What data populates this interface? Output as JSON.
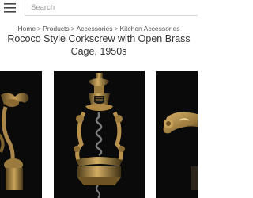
{
  "search": {
    "placeholder": "Search"
  },
  "breadcrumb": {
    "items": [
      "Home",
      "Products",
      "Accessories",
      "Kitchen Accessories"
    ],
    "separator": ">"
  },
  "product": {
    "title_lines": [
      "Rococo Style Corkscrew with Open Brass",
      "Cage, 1950s"
    ]
  },
  "colors": {
    "image_background": "#0a0a0a",
    "brass": "#b08a45",
    "text": "#333333"
  },
  "icons": {
    "menu": "hamburger-menu-icon"
  }
}
